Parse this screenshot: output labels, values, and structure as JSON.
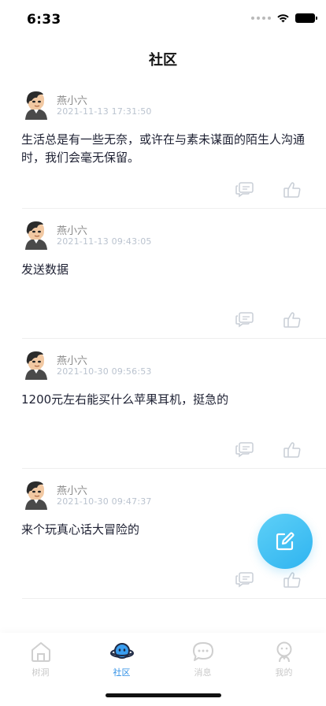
{
  "status_bar": {
    "time": "6:33"
  },
  "header": {
    "title": "社区"
  },
  "posts": [
    {
      "author": "燕小六",
      "timestamp": "2021-11-13 17:31:50",
      "content": "生活总是有一些无奈，或许在与素未谋面的陌生人沟通时，我们会毫无保留。"
    },
    {
      "author": "燕小六",
      "timestamp": "2021-11-13 09:43:05",
      "content": "发送数据"
    },
    {
      "author": "燕小六",
      "timestamp": "2021-10-30 09:56:53",
      "content": "1200元左右能买什么苹果耳机，挺急的"
    },
    {
      "author": "燕小六",
      "timestamp": "2021-10-30 09:47:37",
      "content": "来个玩真心话大冒险的"
    }
  ],
  "post_actions": {
    "comment_icon": "comment-icon",
    "like_icon": "thumbs-up-icon"
  },
  "fab": {
    "icon": "edit-icon",
    "color": "#3bbcf2"
  },
  "tabbar": {
    "items": [
      {
        "label": "树洞",
        "icon": "home-icon",
        "active": false
      },
      {
        "label": "社区",
        "icon": "planet-icon",
        "active": true
      },
      {
        "label": "消息",
        "icon": "chat-bubble-icon",
        "active": false
      },
      {
        "label": "我的",
        "icon": "profile-icon",
        "active": false
      }
    ],
    "active_color": "#2f8fe6",
    "inactive_color": "#c9c9c9"
  }
}
